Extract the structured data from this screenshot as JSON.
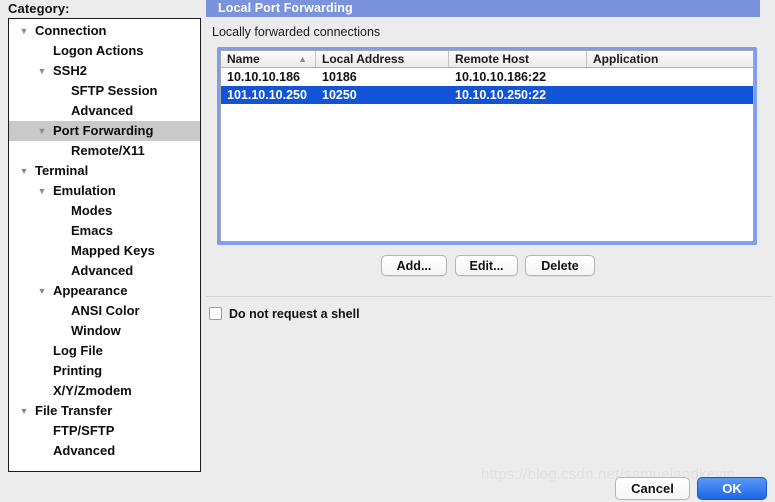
{
  "sidebar": {
    "heading": "Category:",
    "items": [
      {
        "label": "Connection",
        "level": 0,
        "arrow": "▼",
        "selected": false
      },
      {
        "label": "Logon Actions",
        "level": 1,
        "arrow": "",
        "selected": false
      },
      {
        "label": "SSH2",
        "level": 1,
        "arrow": "▼",
        "selected": false
      },
      {
        "label": "SFTP Session",
        "level": 2,
        "arrow": "",
        "selected": false
      },
      {
        "label": "Advanced",
        "level": 2,
        "arrow": "",
        "selected": false
      },
      {
        "label": "Port Forwarding",
        "level": 1,
        "arrow": "▼",
        "selected": true
      },
      {
        "label": "Remote/X11",
        "level": 2,
        "arrow": "",
        "selected": false
      },
      {
        "label": "Terminal",
        "level": 0,
        "arrow": "▼",
        "selected": false
      },
      {
        "label": "Emulation",
        "level": 1,
        "arrow": "▼",
        "selected": false
      },
      {
        "label": "Modes",
        "level": 2,
        "arrow": "",
        "selected": false
      },
      {
        "label": "Emacs",
        "level": 2,
        "arrow": "",
        "selected": false
      },
      {
        "label": "Mapped Keys",
        "level": 2,
        "arrow": "",
        "selected": false
      },
      {
        "label": "Advanced",
        "level": 2,
        "arrow": "",
        "selected": false
      },
      {
        "label": "Appearance",
        "level": 1,
        "arrow": "▼",
        "selected": false
      },
      {
        "label": "ANSI Color",
        "level": 2,
        "arrow": "",
        "selected": false
      },
      {
        "label": "Window",
        "level": 2,
        "arrow": "",
        "selected": false
      },
      {
        "label": "Log File",
        "level": 1,
        "arrow": "",
        "selected": false
      },
      {
        "label": "Printing",
        "level": 1,
        "arrow": "",
        "selected": false
      },
      {
        "label": "X/Y/Zmodem",
        "level": 1,
        "arrow": "",
        "selected": false
      },
      {
        "label": "File Transfer",
        "level": 0,
        "arrow": "▼",
        "selected": false
      },
      {
        "label": "FTP/SFTP",
        "level": 1,
        "arrow": "",
        "selected": false
      },
      {
        "label": "Advanced",
        "level": 1,
        "arrow": "",
        "selected": false
      }
    ]
  },
  "pane": {
    "title": "Local Port Forwarding",
    "section_label": "Locally forwarded connections"
  },
  "table": {
    "columns": [
      {
        "label": "Name",
        "sort_arrow": "▲"
      },
      {
        "label": "Local Address",
        "sort_arrow": ""
      },
      {
        "label": "Remote Host",
        "sort_arrow": ""
      },
      {
        "label": "Application",
        "sort_arrow": ""
      }
    ],
    "rows": [
      {
        "name": "10.10.10.186",
        "local_address": "10186",
        "remote_host": "10.10.10.186:22",
        "application": "",
        "selected": false
      },
      {
        "name": "101.10.10.250",
        "local_address": "10250",
        "remote_host": "10.10.10.250:22",
        "application": "",
        "selected": true
      }
    ]
  },
  "actions": {
    "add_label": "Add...",
    "edit_label": "Edit...",
    "delete_label": "Delete"
  },
  "options": {
    "shell_label": "Do not request a shell",
    "shell_checked": false
  },
  "footer": {
    "cancel_label": "Cancel",
    "ok_label": "OK"
  },
  "watermark": {
    "text": "https://blog.csdn.net/samuelandkevin"
  },
  "colors": {
    "title_bar": "#7b93dd",
    "selection_blue": "#1154d8",
    "focus_ring": "#7f9df0",
    "tree_selection_gray": "#c9c9c9",
    "ok_button_blue": "#2f73ee",
    "window_background": "#ececec"
  }
}
